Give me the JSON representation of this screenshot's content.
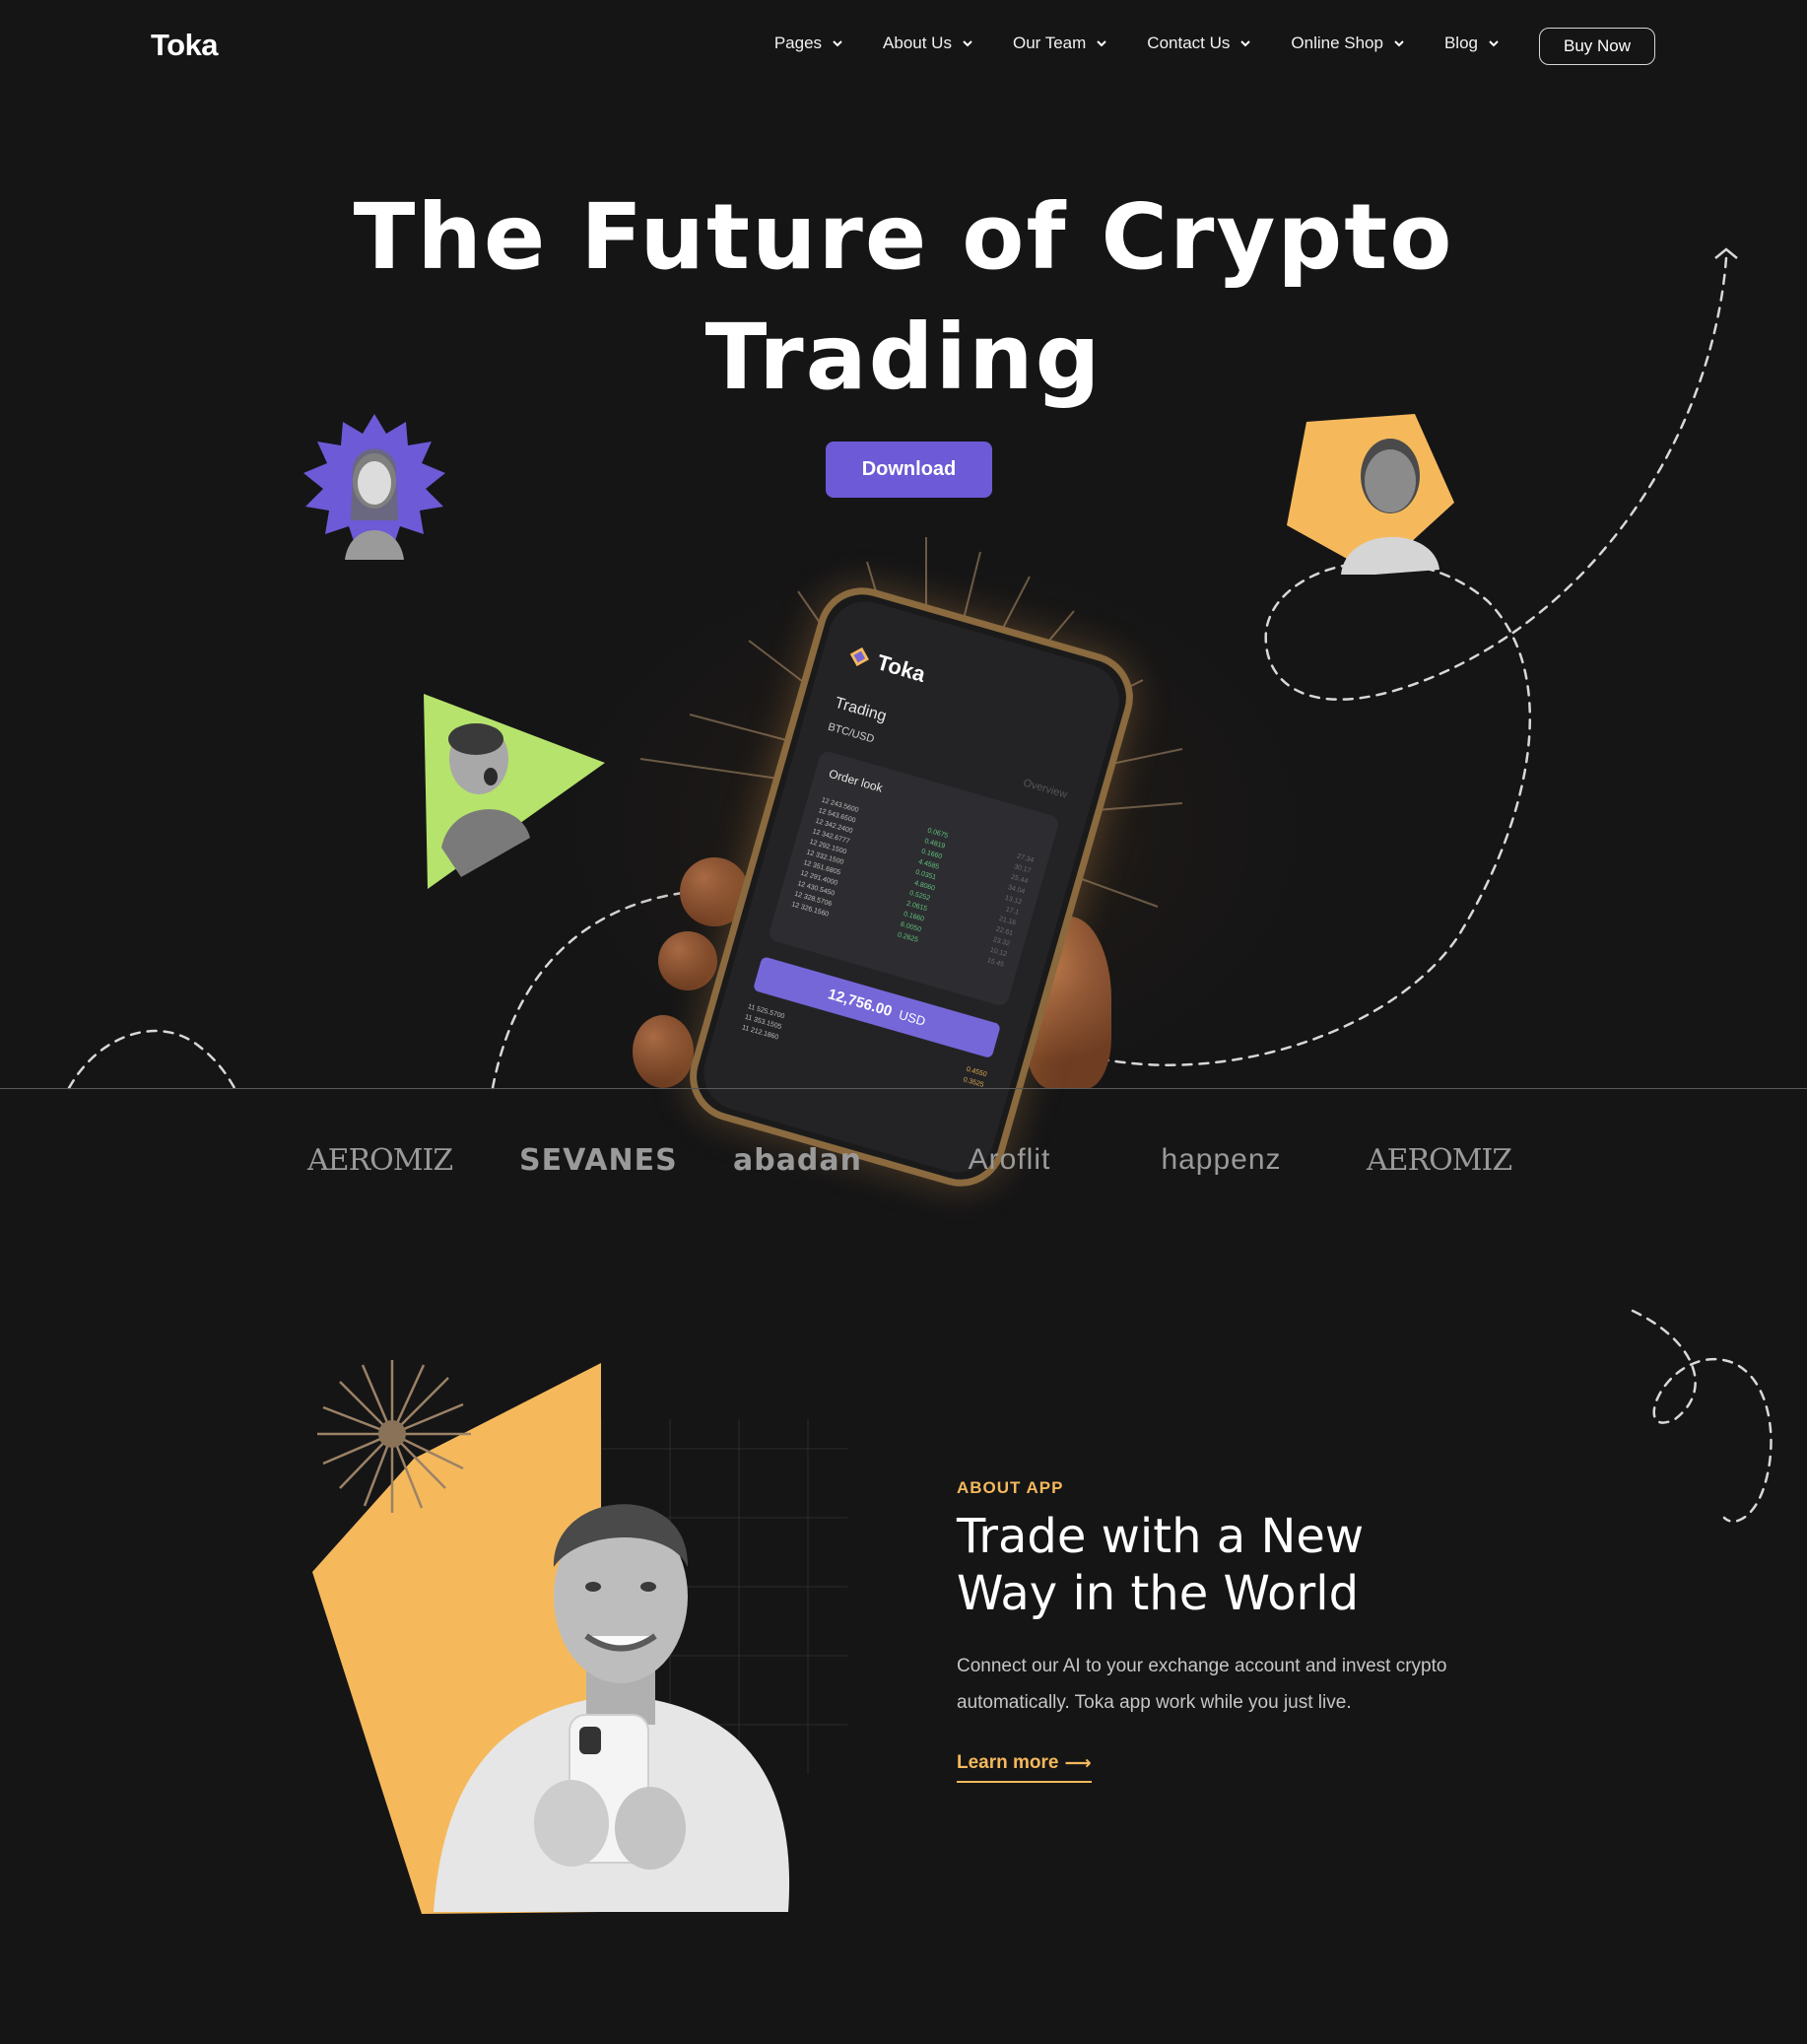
{
  "nav": {
    "logo": "Toka",
    "menu": [
      {
        "label": "Pages"
      },
      {
        "label": "About Us"
      },
      {
        "label": "Our Team"
      },
      {
        "label": "Contact Us"
      },
      {
        "label": "Online Shop"
      },
      {
        "label": "Blog"
      }
    ],
    "buy_label": "Buy Now"
  },
  "hero": {
    "title_line1": "The Future of Crypto",
    "title_line2": "Trading",
    "download_label": "Download"
  },
  "phone": {
    "app_name": "Toka",
    "section": "Trading",
    "pair": "BTC/USD",
    "overview": "Overview",
    "order_book_title": "Order look",
    "rows": [
      [
        "12 243.5600",
        "0.0675",
        "27.34"
      ],
      [
        "12 543.6500",
        "0.4819",
        "30.17"
      ],
      [
        "12 342.2400",
        "0.1660",
        "25.44"
      ],
      [
        "12 342.6777",
        "4.4585",
        "34.04"
      ],
      [
        "12 292.1500",
        "0.0351",
        "13.12"
      ],
      [
        "12 332.1500",
        "4.8060",
        "17.1"
      ],
      [
        "12 351.6805",
        "0.5252",
        "21.16"
      ],
      [
        "12 291.4000",
        "2.0615",
        "22.61"
      ],
      [
        "12 430.5450",
        "0.1660",
        "23.32"
      ],
      [
        "12 328.5706",
        "6.0050",
        "10.12"
      ],
      [
        "12 326.1560",
        "0.2625",
        "15.45"
      ]
    ],
    "total_value": "12,756.00",
    "total_unit": "USD",
    "extra_rows": [
      [
        "11 525.5700",
        "0.4550"
      ],
      [
        "11 353.1505",
        "0.3525"
      ],
      [
        "11 212.1860",
        ""
      ]
    ]
  },
  "partners": [
    "AEROMIZ",
    "SEVANES",
    "abadan",
    "Aroflit",
    "happenz",
    "AEROMIZ"
  ],
  "about": {
    "tag": "ABOUT APP",
    "title_line1": "Trade with a New",
    "title_line2": "Way in the World",
    "text_line1": "Connect our AI to your exchange account and invest crypto",
    "text_line2": "automatically. Toka app work while you just live.",
    "link_label": "Learn more",
    "link_arrow": "⟶"
  },
  "colors": {
    "background": "#151516",
    "primary": "#6c5ad6",
    "accent": "#f5b95c",
    "lime": "#b6e36c"
  },
  "icons": {
    "chevron": "chevron-down-icon",
    "arrow": "arrow-right-icon"
  }
}
